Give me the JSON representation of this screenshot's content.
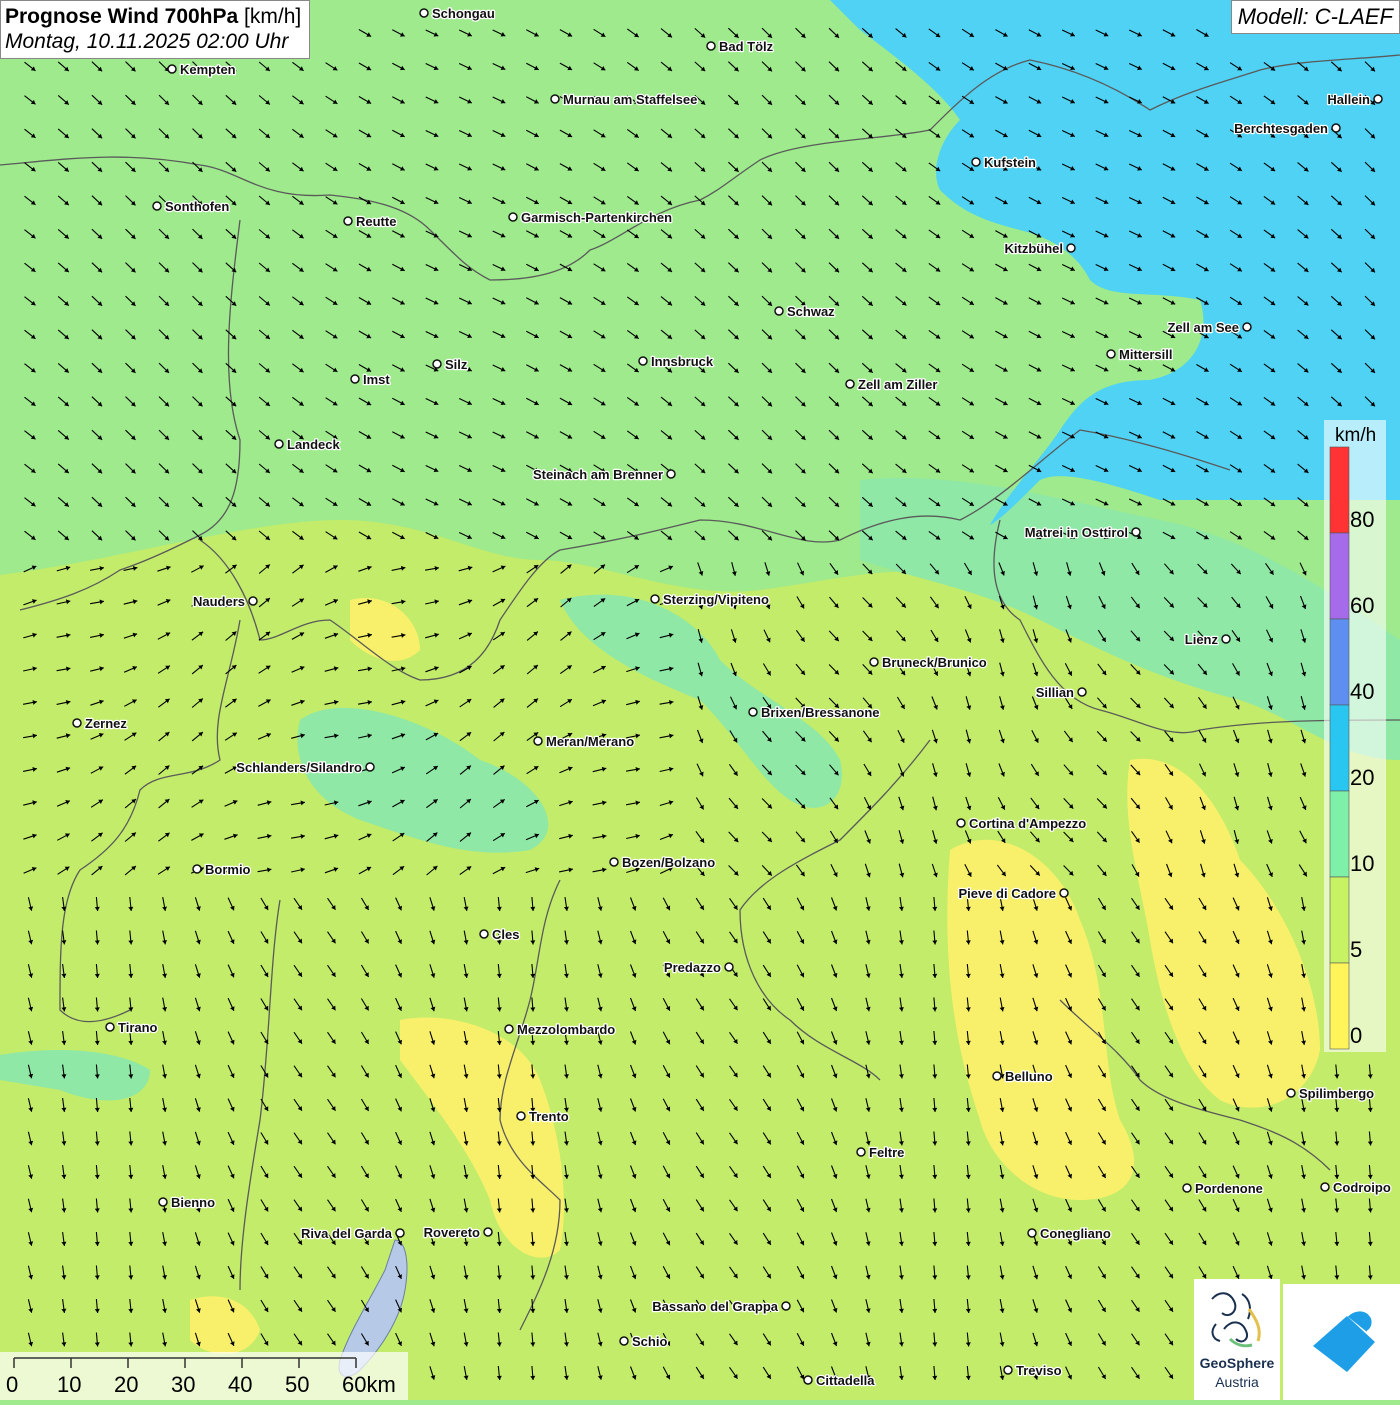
{
  "header": {
    "title": "Prognose Wind 700hPa",
    "unit": "[km/h]",
    "datetime": "Montag, 10.11.2025 02:00 Uhr",
    "model": "Modell: C-LAEF"
  },
  "legend": {
    "unit": "km/h",
    "labels": [
      "80",
      "60",
      "40",
      "20",
      "10",
      "5",
      "0"
    ],
    "colors": [
      "#ff3333",
      "#a66bea",
      "#5e8ff0",
      "#29c6f2",
      "#7ff0a8",
      "#c6f263",
      "#fff45a"
    ]
  },
  "scale_bar": {
    "labels": [
      "0",
      "10",
      "20",
      "30",
      "40",
      "50",
      "60km"
    ]
  },
  "logos": {
    "geosphere_line1": "GeoSphere",
    "geosphere_line2": "Austria"
  },
  "colors": {
    "blue_zone": "#4fd2f4",
    "green_zone": "#9eea8c",
    "teal_zone": "#8fe8a6",
    "lime_zone": "#c2ec6a",
    "yellow_zone": "#f8f06a",
    "borders": "#5a5a5a",
    "arrows": "#000000"
  },
  "cities": [
    {
      "name": "Schongau"
    },
    {
      "name": "Bad Tölz"
    },
    {
      "name": "Kempten"
    },
    {
      "name": "Murnau am Staffelsee"
    },
    {
      "name": "Hallein"
    },
    {
      "name": "Berchtesgaden"
    },
    {
      "name": "Kufstein"
    },
    {
      "name": "Sonthofen"
    },
    {
      "name": "Reutte"
    },
    {
      "name": "Garmisch-Partenkirchen"
    },
    {
      "name": "Kitzbühel"
    },
    {
      "name": "Schwaz"
    },
    {
      "name": "Zell am See"
    },
    {
      "name": "Mittersill"
    },
    {
      "name": "Innsbruck"
    },
    {
      "name": "Silz"
    },
    {
      "name": "Imst"
    },
    {
      "name": "Zell am Ziller"
    },
    {
      "name": "Landeck"
    },
    {
      "name": "Steinach am Brenner"
    },
    {
      "name": "Matrei in Osttirol"
    },
    {
      "name": "Nauders"
    },
    {
      "name": "Sterzing/Vipiteno"
    },
    {
      "name": "Lienz"
    },
    {
      "name": "Bruneck/Brunico"
    },
    {
      "name": "Sillian"
    },
    {
      "name": "Brixen/Bressanone"
    },
    {
      "name": "Zernez"
    },
    {
      "name": "Meran/Merano"
    },
    {
      "name": "Schlanders/Silandro"
    },
    {
      "name": "Cortina d'Ampezzo"
    },
    {
      "name": "Bozen/Bolzano"
    },
    {
      "name": "Bormio"
    },
    {
      "name": "Pieve di Cadore"
    },
    {
      "name": "Cles"
    },
    {
      "name": "Predazzo"
    },
    {
      "name": "Tirano"
    },
    {
      "name": "Mezzolombardo"
    },
    {
      "name": "Belluno"
    },
    {
      "name": "Spilimbergo"
    },
    {
      "name": "Trento"
    },
    {
      "name": "Feltre"
    },
    {
      "name": "Pordenone"
    },
    {
      "name": "Codroipo"
    },
    {
      "name": "Bienno"
    },
    {
      "name": "Riva del Garda"
    },
    {
      "name": "Rovereto"
    },
    {
      "name": "Conegliano"
    },
    {
      "name": "Bassano del Grappa"
    },
    {
      "name": "Schio"
    },
    {
      "name": "Treviso"
    },
    {
      "name": "Cittadella"
    }
  ]
}
